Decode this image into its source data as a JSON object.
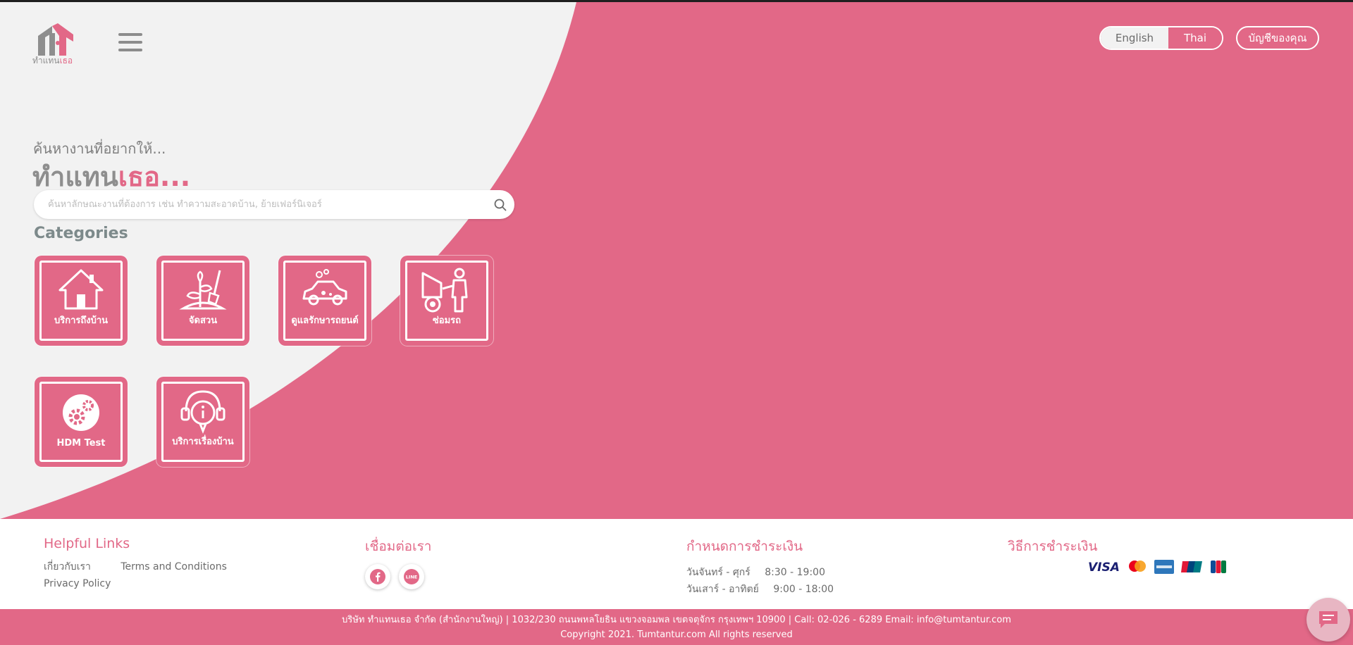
{
  "brand": {
    "logo_text_gray": "ทำแทน",
    "logo_text_pink": "เธอ",
    "accent": "#e26887",
    "gray": "#8e8e8e",
    "bg": "#f2f2f2"
  },
  "header": {
    "lang_en": "English",
    "lang_th": "Thai",
    "account": "บัญชีของคุณ"
  },
  "hero": {
    "subtitle": "ค้นหางานที่อยากให้...",
    "title_gray": "ทำแทน",
    "title_pink": "เธอ...",
    "search_placeholder": "ค้นหาลักษณะงานที่ต้องการ เช่น ทำความสะอาดบ้าน, ย้ายเฟอร์นิเจอร์"
  },
  "categories": {
    "title": "Categories",
    "items": [
      {
        "label": "บริการถึงบ้าน",
        "icon": "house-icon"
      },
      {
        "label": "จัดสวน",
        "icon": "garden-icon"
      },
      {
        "label": "ดูแลรักษารถยนต์",
        "icon": "car-care-icon"
      },
      {
        "label": "ซ่อมรถ",
        "icon": "mechanic-icon"
      },
      {
        "label": "HDM Test",
        "icon": "gear-icon"
      },
      {
        "label": "บริการเรื่องบ้าน",
        "icon": "info-headset-icon"
      }
    ]
  },
  "footer": {
    "helpful_title": "Helpful Links",
    "links": {
      "about": "เกี่ยวกับเรา",
      "terms": "Terms and Conditions",
      "privacy": "Privacy Policy"
    },
    "connect_title": "เชื่อมต่อเรา",
    "social": [
      "facebook-icon",
      "line-icon"
    ],
    "schedule_title": "กำหนดการชำระเงิน",
    "schedule": [
      {
        "days": "วันจันทร์ - ศุกร์",
        "hours": "8:30 - 19:00"
      },
      {
        "days": "วันเสาร์ - อาทิตย์",
        "hours": "9:00 - 18:00"
      }
    ],
    "payment_title": "วิธีการชำระเงิน",
    "payment_logos": [
      "visa-icon",
      "mastercard-icon",
      "amex-icon",
      "unionpay-icon",
      "jcb-icon"
    ],
    "visa_text": "VISA",
    "line_text": "LINE"
  },
  "bottombar": {
    "address": "บริษัท ทำแทนเธอ จำกัด (สำนักงานใหญ่) | 1032/230 ถนนพหลโยธิน แขวงจอมพล เขตจตุจักร กรุงเทพฯ 10900 | Call: 02-026 - 6289 Email: info@tumtantur.com",
    "copyright": "Copyright 2021. Tumtantur.com All rights reserved"
  }
}
